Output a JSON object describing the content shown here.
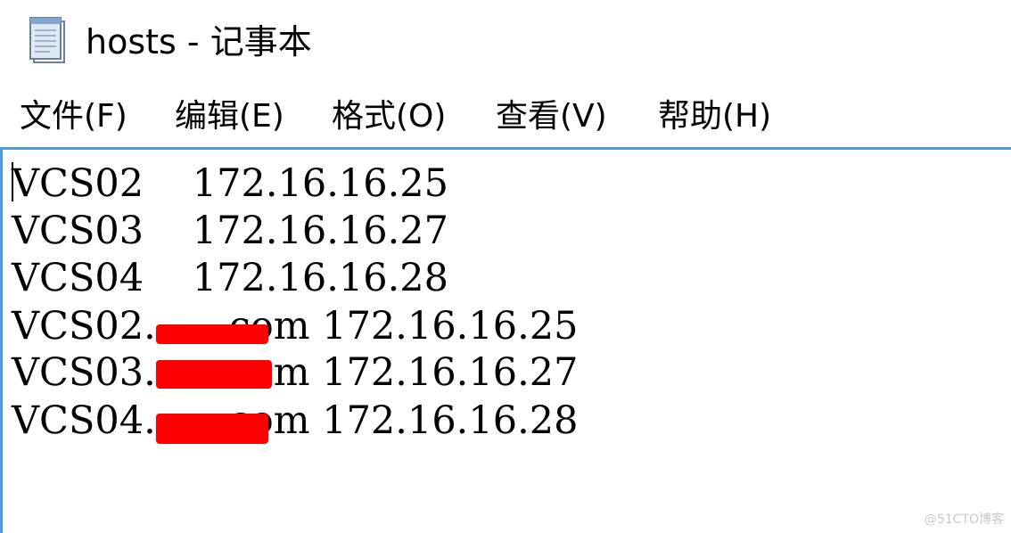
{
  "window": {
    "title": "hosts - 记事本",
    "app_icon": "notepad-icon"
  },
  "menu": {
    "items": [
      {
        "label": "文件(F)"
      },
      {
        "label": "编辑(E)"
      },
      {
        "label": "格式(O)"
      },
      {
        "label": "查看(V)"
      },
      {
        "label": "帮助(H)"
      }
    ]
  },
  "editor": {
    "lines": [
      {
        "text": "VCS02    172.16.16.25"
      },
      {
        "text": "VCS03    172.16.16.27"
      },
      {
        "text": "VCS04    172.16.16.28"
      },
      {
        "text": "VCS02.     .com 172.16.16.25",
        "redacted": true
      },
      {
        "text": "VCS03.     .com 172.16.16.27",
        "redacted": true
      },
      {
        "text": "VCS04.     .com 172.16.16.28",
        "redacted": true
      }
    ],
    "redaction_color": "#ff0000",
    "focus_border_color": "#4a9ede"
  },
  "watermark": {
    "text": "@51CTO博客"
  }
}
